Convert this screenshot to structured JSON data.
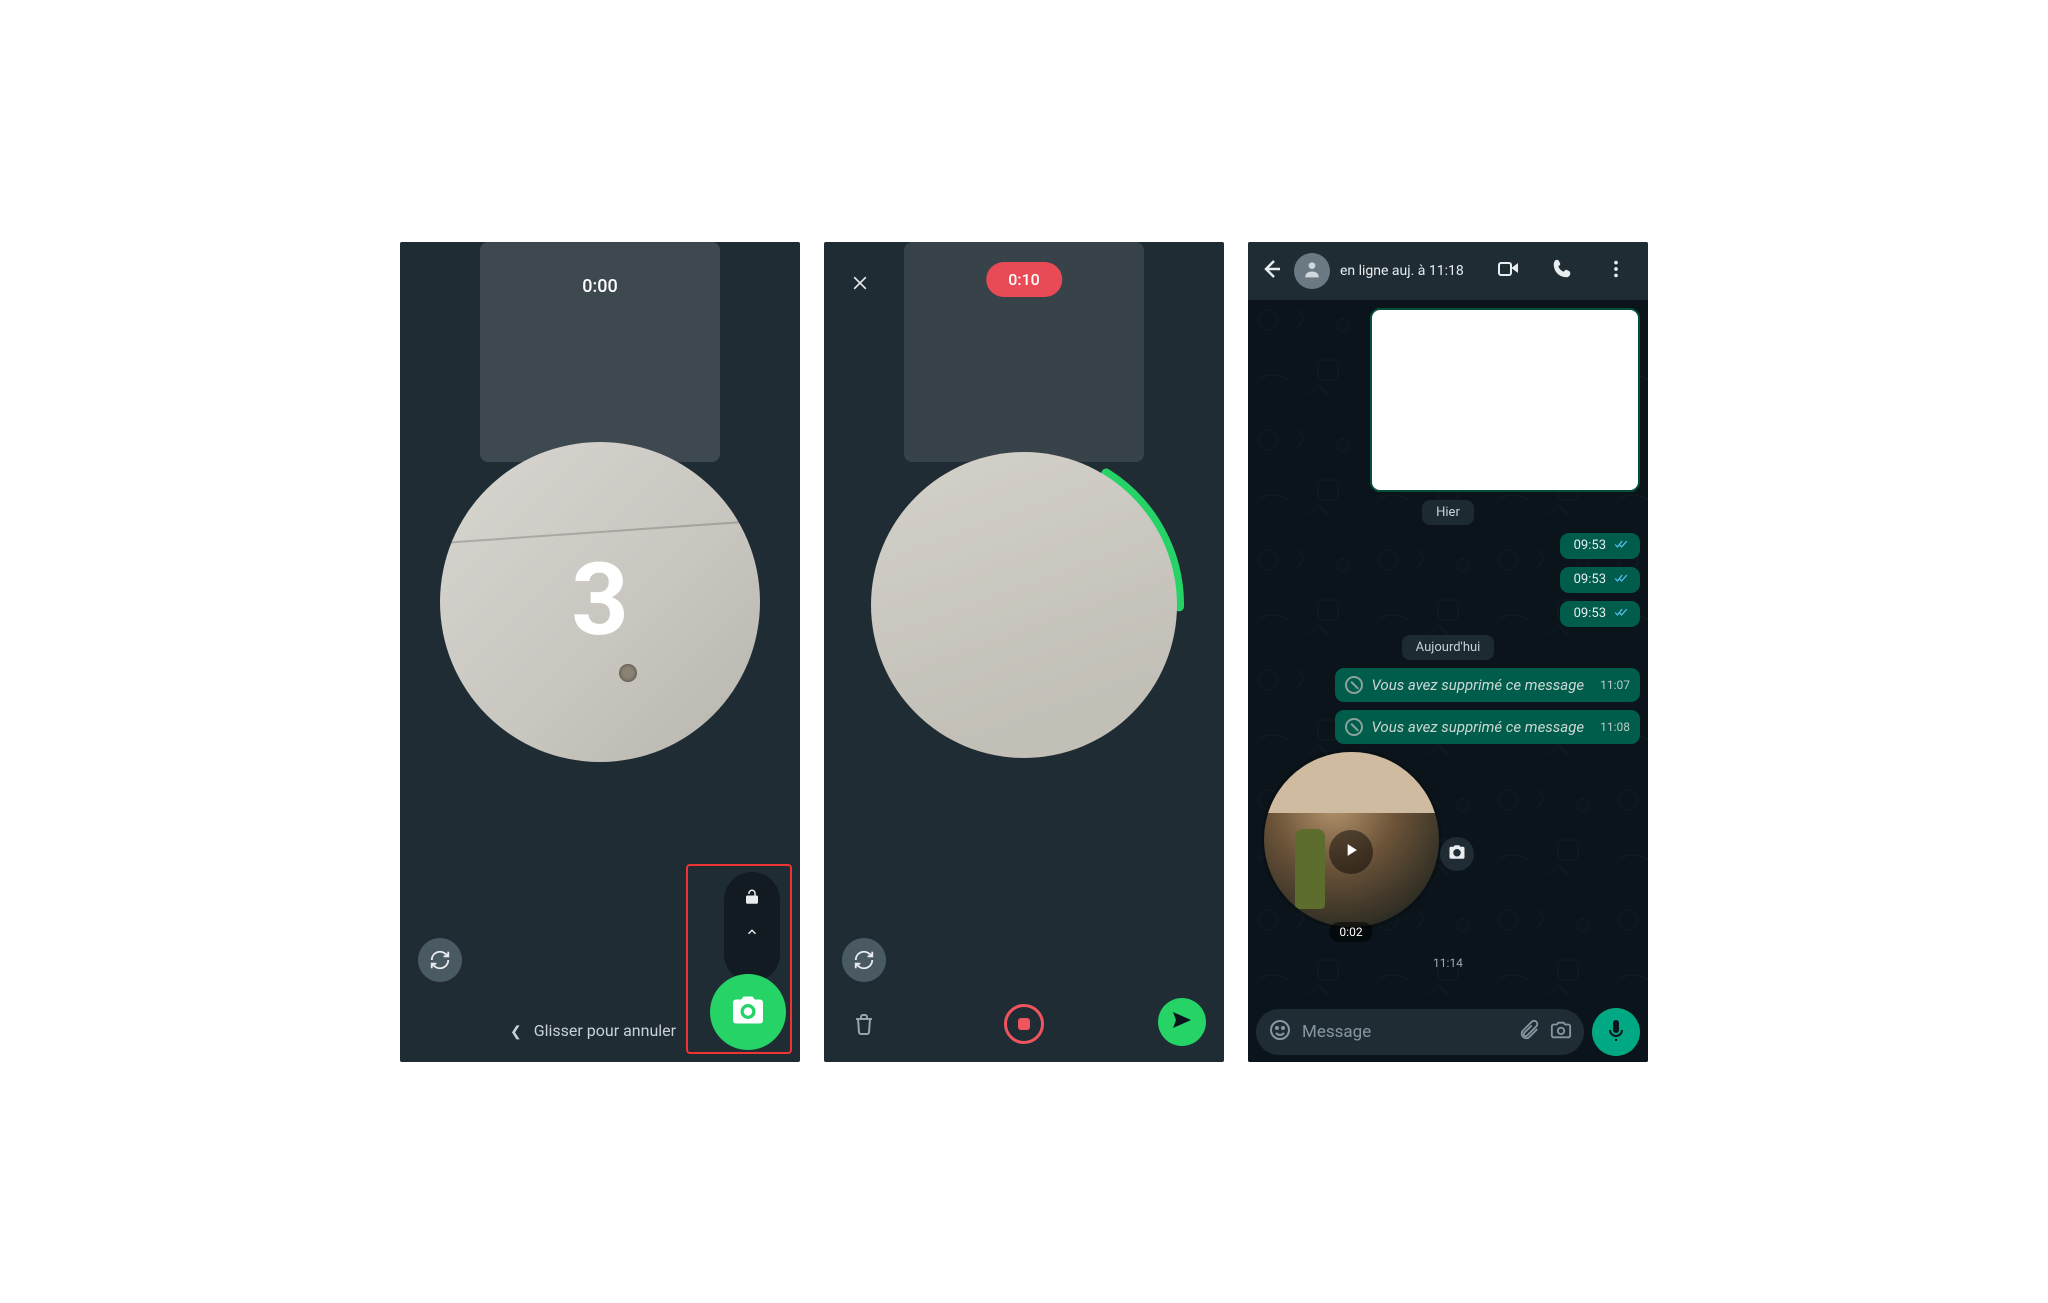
{
  "screen1": {
    "timer": "0:00",
    "countdown": "3",
    "cancel_hint": "Glisser pour annuler"
  },
  "screen2": {
    "duration": "0:10"
  },
  "screen3": {
    "header": {
      "status": "en ligne auj. à 11:18"
    },
    "day1": "Hier",
    "stubs": [
      "09:53",
      "09:53",
      "09:53"
    ],
    "day2": "Aujourd'hui",
    "deleted_text": "Vous avez supprimé ce message",
    "deleted": [
      {
        "time": "11:07"
      },
      {
        "time": "11:08"
      }
    ],
    "video_msg": {
      "duration": "0:02",
      "sent_time": "11:14"
    },
    "input": {
      "placeholder": "Message"
    }
  }
}
